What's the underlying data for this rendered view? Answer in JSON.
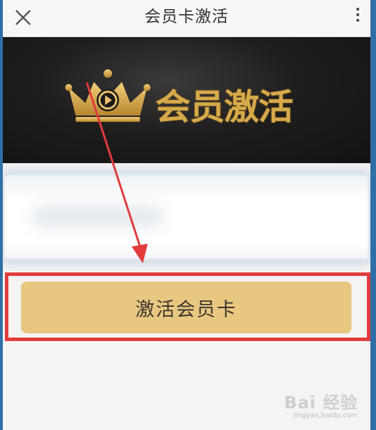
{
  "header": {
    "title": "会员卡激活"
  },
  "banner": {
    "text": "会员激活"
  },
  "main": {
    "activate_button_label": "激活会员卡"
  },
  "watermark": {
    "logo": "Bai 经验",
    "url": "jingyan.baidu.com"
  },
  "colors": {
    "button_bg": "#e8c881",
    "highlight": "#e23b3b",
    "gold": "#d6a94a"
  }
}
